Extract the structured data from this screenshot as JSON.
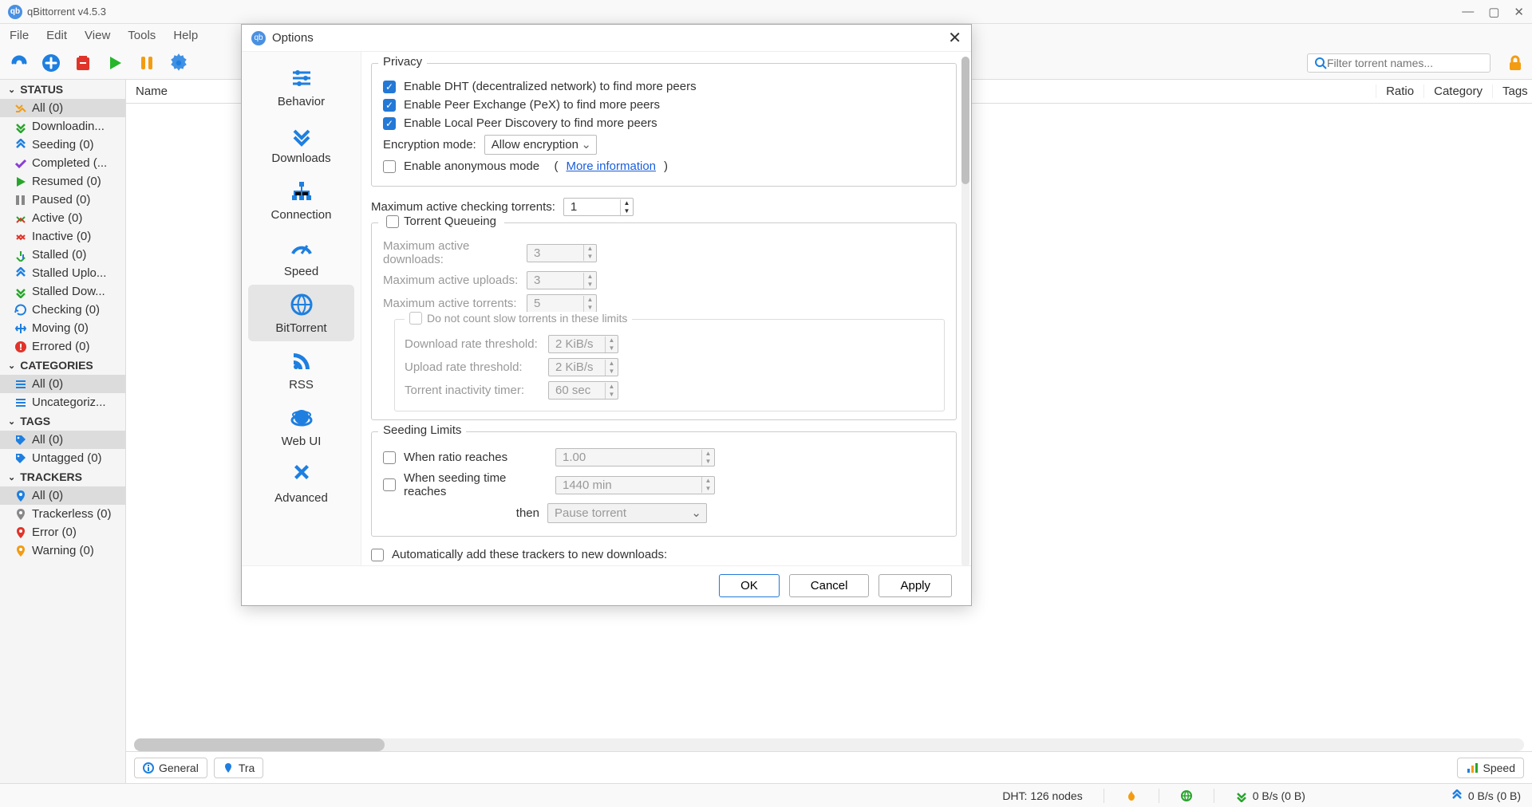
{
  "titlebar": {
    "title": "qBittorrent v4.5.3"
  },
  "menubar": [
    "File",
    "Edit",
    "View",
    "Tools",
    "Help"
  ],
  "search": {
    "placeholder": "Filter torrent names..."
  },
  "sidebar": {
    "status": {
      "header": "STATUS",
      "items": [
        {
          "label": "All (0)"
        },
        {
          "label": "Downloadin..."
        },
        {
          "label": "Seeding (0)"
        },
        {
          "label": "Completed (..."
        },
        {
          "label": "Resumed (0)"
        },
        {
          "label": "Paused (0)"
        },
        {
          "label": "Active (0)"
        },
        {
          "label": "Inactive (0)"
        },
        {
          "label": "Stalled (0)"
        },
        {
          "label": "Stalled Uplo..."
        },
        {
          "label": "Stalled Dow..."
        },
        {
          "label": "Checking (0)"
        },
        {
          "label": "Moving (0)"
        },
        {
          "label": "Errored (0)"
        }
      ]
    },
    "categories": {
      "header": "CATEGORIES",
      "items": [
        {
          "label": "All (0)"
        },
        {
          "label": "Uncategoriz..."
        }
      ]
    },
    "tags": {
      "header": "TAGS",
      "items": [
        {
          "label": "All (0)"
        },
        {
          "label": "Untagged (0)"
        }
      ]
    },
    "trackers": {
      "header": "TRACKERS",
      "items": [
        {
          "label": "All (0)"
        },
        {
          "label": "Trackerless (0)"
        },
        {
          "label": "Error (0)"
        },
        {
          "label": "Warning (0)"
        }
      ]
    }
  },
  "columns": {
    "name": "Name",
    "ratio": "Ratio",
    "category": "Category",
    "tags": "Tags"
  },
  "bottomTabs": {
    "general": "General",
    "trackers": "Tra",
    "speed": "Speed"
  },
  "statusbar": {
    "dht": "DHT: 126 nodes",
    "down": "0 B/s (0 B)",
    "up": "0 B/s (0 B)"
  },
  "dialog": {
    "title": "Options",
    "sidebar": [
      "Behavior",
      "Downloads",
      "Connection",
      "Speed",
      "BitTorrent",
      "RSS",
      "Web UI",
      "Advanced"
    ],
    "privacy": {
      "legend": "Privacy",
      "dht": "Enable DHT (decentralized network) to find more peers",
      "pex": "Enable Peer Exchange (PeX) to find more peers",
      "lpd": "Enable Local Peer Discovery to find more peers",
      "encLabel": "Encryption mode:",
      "encValue": "Allow encryption",
      "anon": "Enable anonymous mode",
      "moreInfo": "More information"
    },
    "maxCheck": {
      "label": "Maximum active checking torrents:",
      "value": "1"
    },
    "queue": {
      "legend": "Torrent Queueing",
      "maxDl": {
        "label": "Maximum active downloads:",
        "value": "3"
      },
      "maxUl": {
        "label": "Maximum active uploads:",
        "value": "3"
      },
      "maxT": {
        "label": "Maximum active torrents:",
        "value": "5"
      },
      "slow": {
        "legend": "Do not count slow torrents in these limits",
        "dlRate": {
          "label": "Download rate threshold:",
          "value": "2 KiB/s"
        },
        "ulRate": {
          "label": "Upload rate threshold:",
          "value": "2 KiB/s"
        },
        "inact": {
          "label": "Torrent inactivity timer:",
          "value": "60 sec"
        }
      }
    },
    "seeding": {
      "legend": "Seeding Limits",
      "ratio": {
        "label": "When ratio reaches",
        "value": "1.00"
      },
      "time": {
        "label": "When seeding time reaches",
        "value": "1440 min"
      },
      "thenLabel": "then",
      "thenValue": "Pause torrent"
    },
    "autoTrack": "Automatically add these trackers to new downloads:",
    "buttons": {
      "ok": "OK",
      "cancel": "Cancel",
      "apply": "Apply"
    }
  }
}
